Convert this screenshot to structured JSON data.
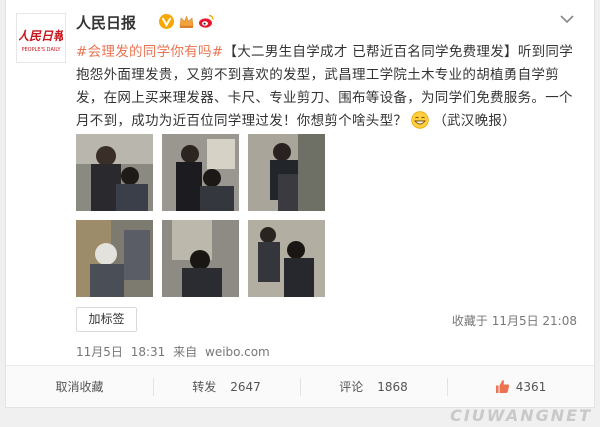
{
  "user": {
    "name": "人民日报",
    "avatar_text": "人民日報",
    "avatar_subtext": "PEOPLE'S DAILY"
  },
  "post": {
    "hashtag": "#会理发的同学你有吗#",
    "body": "【大二男生自学成才 已帮近百名同学免费理发】听到同学抱怨外面理发贵，又剪不到喜欢的发型，武昌理工学院土木专业的胡植勇自学剪发，在网上买来理发器、卡尺、专业剪刀、围布等设备，为同学们免费服务。一个月不到，成功为近百位同学理过发！你想剪个啥头型？",
    "source": "（武汉晚报）"
  },
  "tag_button": "加标签",
  "favorited_time": "收藏于 11月5日 21:08",
  "meta": {
    "date": "11月5日",
    "time": "18:31",
    "from": "来自",
    "client": "weibo.com"
  },
  "actions": {
    "favorite": {
      "label": "取消收藏"
    },
    "repost": {
      "label": "转发",
      "count": "2647"
    },
    "comment": {
      "label": "评论",
      "count": "1868"
    },
    "like": {
      "count": "4361"
    }
  },
  "icons": [
    "verified-icon",
    "crown-icon",
    "weibo-icon",
    "caret-down-icon",
    "grin-emoji-icon",
    "thumbs-up-icon"
  ],
  "colors": {
    "hashtag": "#eb7350",
    "verified": "#f7a700",
    "like": "#eb7350"
  },
  "watermark": "CIUWANGNET"
}
